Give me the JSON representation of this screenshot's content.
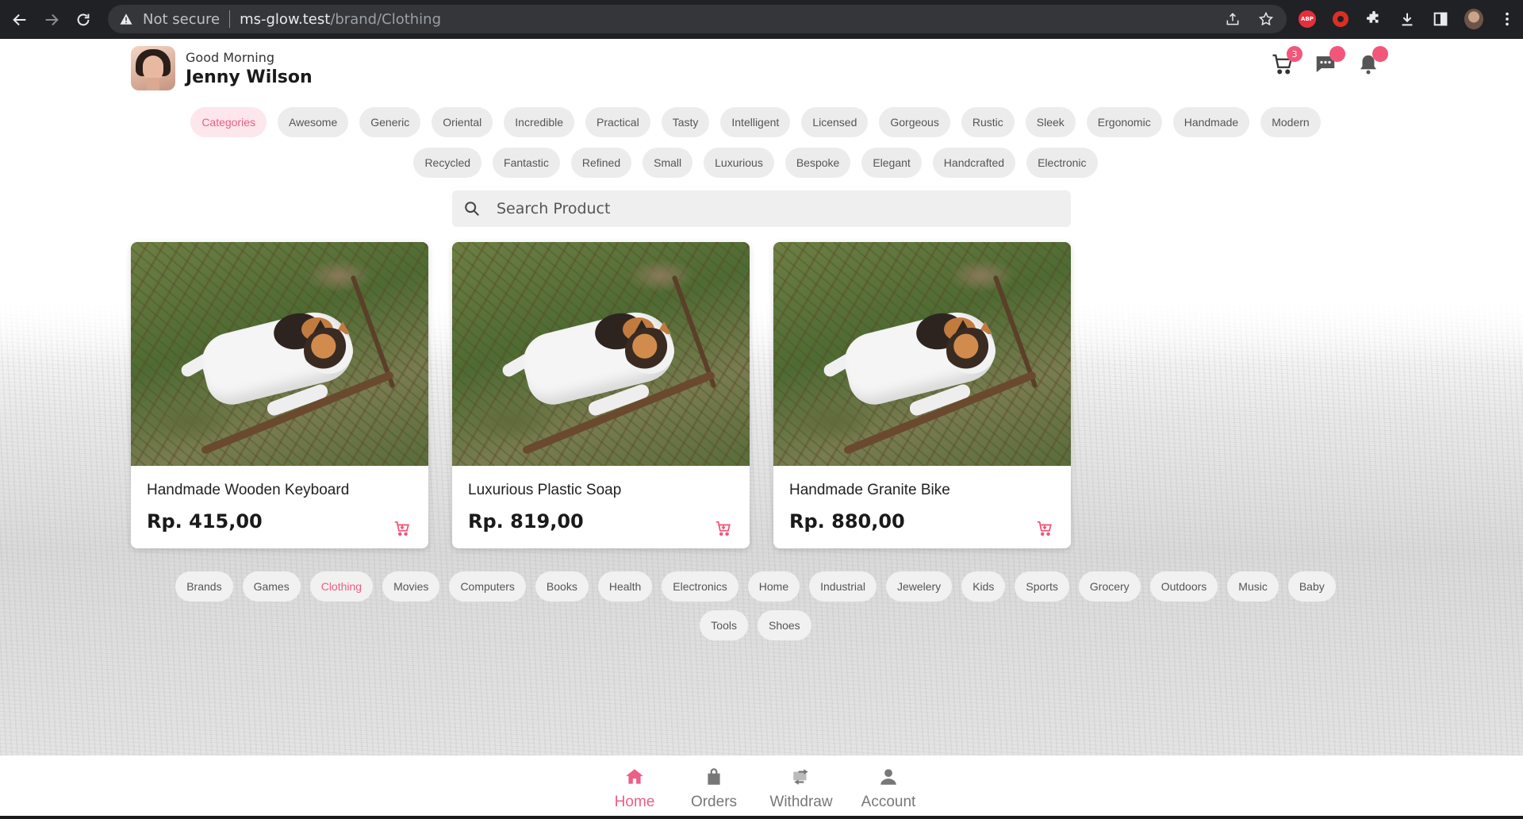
{
  "browser": {
    "security_text": "Not secure",
    "url_host": "ms-glow.test",
    "url_path": "/brand/Clothing",
    "extensions": [
      "abp-icon",
      "record-icon",
      "puzzle-icon",
      "download-icon",
      "sidepanel-icon",
      "profile-avatar",
      "kebab-menu-icon"
    ]
  },
  "header": {
    "greeting": "Good Morning",
    "user_name": "Jenny Wilson",
    "cart_count": "3",
    "icons": [
      "cart-icon",
      "chat-icon",
      "bell-icon"
    ]
  },
  "categories": {
    "items": [
      {
        "label": "Categories",
        "active": true
      },
      {
        "label": "Awesome"
      },
      {
        "label": "Generic"
      },
      {
        "label": "Oriental"
      },
      {
        "label": "Incredible"
      },
      {
        "label": "Practical"
      },
      {
        "label": "Tasty"
      },
      {
        "label": "Intelligent"
      },
      {
        "label": "Licensed"
      },
      {
        "label": "Gorgeous"
      },
      {
        "label": "Rustic"
      },
      {
        "label": "Sleek"
      },
      {
        "label": "Ergonomic"
      },
      {
        "label": "Handmade"
      },
      {
        "label": "Modern"
      },
      {
        "label": "Recycled"
      },
      {
        "label": "Fantastic"
      },
      {
        "label": "Refined"
      },
      {
        "label": "Small"
      },
      {
        "label": "Luxurious"
      },
      {
        "label": "Bespoke"
      },
      {
        "label": "Elegant"
      },
      {
        "label": "Handcrafted"
      },
      {
        "label": "Electronic"
      }
    ]
  },
  "search": {
    "placeholder": "Search Product",
    "value": ""
  },
  "products": [
    {
      "name": "Handmade Wooden Keyboard",
      "price": "Rp. 415,00"
    },
    {
      "name": "Luxurious Plastic Soap",
      "price": "Rp. 819,00"
    },
    {
      "name": "Handmade Granite Bike",
      "price": "Rp. 880,00"
    }
  ],
  "brands": {
    "items": [
      {
        "label": "Brands"
      },
      {
        "label": "Games"
      },
      {
        "label": "Clothing",
        "active": true
      },
      {
        "label": "Movies"
      },
      {
        "label": "Computers"
      },
      {
        "label": "Books"
      },
      {
        "label": "Health"
      },
      {
        "label": "Electronics"
      },
      {
        "label": "Home"
      },
      {
        "label": "Industrial"
      },
      {
        "label": "Jewelery"
      },
      {
        "label": "Kids"
      },
      {
        "label": "Sports"
      },
      {
        "label": "Grocery"
      },
      {
        "label": "Outdoors"
      },
      {
        "label": "Music"
      },
      {
        "label": "Baby"
      },
      {
        "label": "Tools"
      },
      {
        "label": "Shoes"
      }
    ]
  },
  "bottom_nav": {
    "items": [
      {
        "label": "Home",
        "icon": "home-icon",
        "active": true
      },
      {
        "label": "Orders",
        "icon": "bag-icon"
      },
      {
        "label": "Withdraw",
        "icon": "transfer-icon"
      },
      {
        "label": "Account",
        "icon": "user-icon"
      }
    ]
  },
  "colors": {
    "accent": "#ec5e84",
    "active_chip_bg": "#fde6ec",
    "chip_bg": "#ececec"
  }
}
